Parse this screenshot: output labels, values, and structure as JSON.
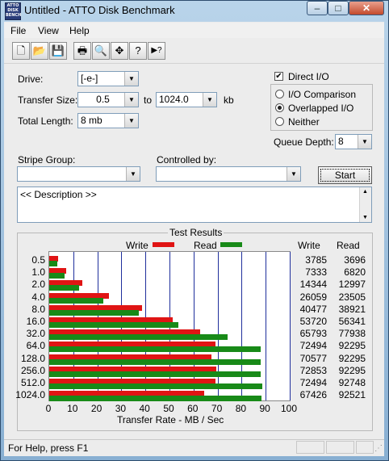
{
  "window": {
    "title": "Untitled - ATTO Disk Benchmark",
    "icon_text": "ATTO DISK BENCH",
    "minimize": "–",
    "maximize": "□",
    "close": "✕"
  },
  "menu": [
    "File",
    "View",
    "Help"
  ],
  "toolbar": [
    {
      "icon": "new-document-icon",
      "glyph": "🗋"
    },
    {
      "icon": "open-folder-icon",
      "glyph": "📂"
    },
    {
      "icon": "save-icon",
      "glyph": "💾"
    },
    {
      "icon": "print-icon",
      "glyph": "🖶"
    },
    {
      "icon": "print-preview-icon",
      "glyph": "🔍"
    },
    {
      "icon": "move-icon",
      "glyph": "✥"
    },
    {
      "icon": "help-icon",
      "glyph": "?"
    },
    {
      "icon": "context-help-icon",
      "glyph": "▶?"
    }
  ],
  "settings": {
    "drive_label": "Drive:",
    "drive_value": "[-e-]",
    "transfer_size_label": "Transfer Size:",
    "transfer_from": "0.5",
    "transfer_to_label": "to",
    "transfer_to": "1024.0",
    "transfer_unit": "kb",
    "total_length_label": "Total Length:",
    "total_length_value": "8 mb",
    "direct_io_label": "Direct I/O",
    "direct_io_checked": "✔",
    "radio_io_comparison": "I/O Comparison",
    "radio_overlapped": "Overlapped I/O",
    "radio_neither": "Neither",
    "queue_depth_label": "Queue Depth:",
    "queue_depth_value": "8",
    "stripe_group_label": "Stripe Group:",
    "controlled_by_label": "Controlled by:",
    "start_label": "Start",
    "description": "<< Description >>"
  },
  "results": {
    "title": "Test Results",
    "legend_write": "Write",
    "legend_read": "Read",
    "col_write": "Write",
    "col_read": "Read"
  },
  "chart_data": {
    "type": "bar",
    "orientation": "horizontal",
    "title": "Test Results",
    "xlabel": "Transfer Rate - MB / Sec",
    "xlim": [
      0,
      100
    ],
    "xticks": [
      "0",
      "10",
      "20",
      "30",
      "40",
      "50",
      "60",
      "70",
      "80",
      "90",
      "100"
    ],
    "categories": [
      "0.5",
      "1.0",
      "2.0",
      "4.0",
      "8.0",
      "16.0",
      "32.0",
      "64.0",
      "128.0",
      "256.0",
      "512.0",
      "1024.0"
    ],
    "series": [
      {
        "name": "Write",
        "color": "#e01414",
        "values": [
          3.6,
          7.0,
          13.7,
          24.9,
          38.6,
          51.2,
          62.7,
          69.1,
          67.3,
          69.5,
          69.1,
          64.3
        ],
        "labels": [
          "3785",
          "7333",
          "14344",
          "26059",
          "40477",
          "53720",
          "65793",
          "72494",
          "70577",
          "72853",
          "72494",
          "67426"
        ]
      },
      {
        "name": "Read",
        "color": "#188a18",
        "values": [
          3.5,
          6.5,
          12.4,
          22.4,
          37.1,
          53.7,
          74.3,
          88.0,
          88.0,
          88.0,
          88.5,
          88.2
        ],
        "labels": [
          "3696",
          "6820",
          "12997",
          "23505",
          "38921",
          "56341",
          "77938",
          "92295",
          "92295",
          "92295",
          "92748",
          "92521"
        ]
      }
    ],
    "grid": true,
    "legend": "top"
  },
  "status": {
    "text": "For Help, press F1"
  }
}
